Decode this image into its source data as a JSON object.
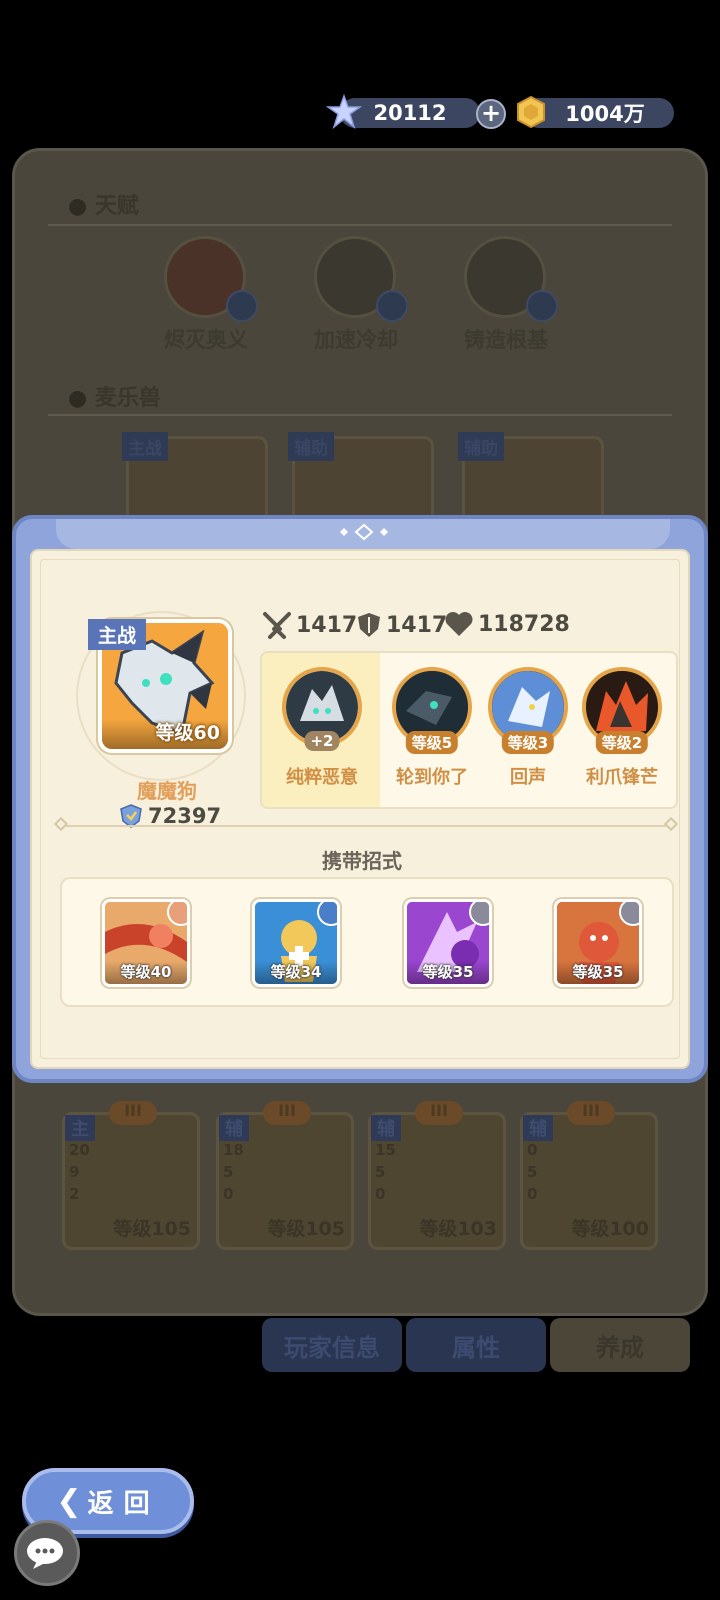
{
  "currency": {
    "gems": "20112",
    "gold": "1004万",
    "add_label": "+"
  },
  "background": {
    "talent_title": "天赋",
    "talents": [
      "烬灭奥义",
      "加速冷却",
      "铸造根基"
    ],
    "beast_title": "麦乐兽",
    "beast_tags": [
      "主战",
      "辅助",
      "辅助"
    ],
    "lower_cards": [
      {
        "tag": "主",
        "rank": "III",
        "nums": [
          "20",
          "9",
          "2"
        ],
        "level": "等级105"
      },
      {
        "tag": "辅",
        "rank": "III",
        "nums": [
          "18",
          "5",
          "0"
        ],
        "level": "等级105"
      },
      {
        "tag": "辅",
        "rank": "III",
        "nums": [
          "15",
          "5",
          "0"
        ],
        "level": "等级103"
      },
      {
        "tag": "辅",
        "rank": "III",
        "nums": [
          "0",
          "5",
          "0"
        ],
        "level": "等级100"
      }
    ],
    "tabs": [
      "玩家信息",
      "属性",
      "养成"
    ]
  },
  "modal": {
    "role_tag": "主战",
    "pet_level": "等级60",
    "pet_name": "魔魔狗",
    "power": "72397",
    "stats": {
      "attack": "1417",
      "defense": "1417",
      "hp": "118728"
    },
    "skills": [
      {
        "name": "纯粹恶意",
        "badge": "+2"
      },
      {
        "name": "轮到你了",
        "badge": "等级5"
      },
      {
        "name": "回声",
        "badge": "等级3"
      },
      {
        "name": "利爪锋芒",
        "badge": "等级2"
      }
    ],
    "moves_title": "携带招式",
    "moves": [
      {
        "level": "等级40"
      },
      {
        "level": "等级34"
      },
      {
        "level": "等级35"
      },
      {
        "level": "等级35"
      }
    ]
  },
  "back_label": "返回",
  "colors": {
    "modal_blue": "#8ea4da",
    "cream": "#f6f0dc",
    "orange": "#e5a548"
  }
}
